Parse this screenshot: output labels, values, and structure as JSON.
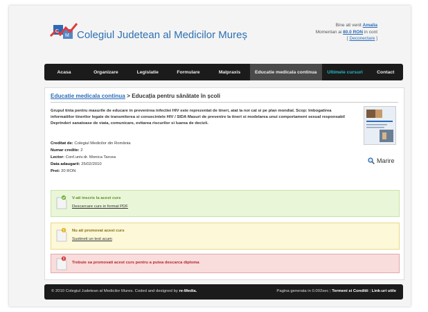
{
  "header": {
    "site_title": "Colegiul Judetean al Medicilor Mureș",
    "welcome": "Bine ati venit",
    "user_name": "Amalia",
    "balance_prefix": "Momentan ai",
    "balance": "80.0 RON",
    "balance_suffix": "in cont",
    "logout": "Deconectare"
  },
  "nav": {
    "items": [
      "Acasa",
      "Organizare",
      "Legislatie",
      "Formulare",
      "Malpraxis",
      "Educatie medicala continua",
      "Ultimele cursuri",
      "Contact"
    ]
  },
  "breadcrumb": {
    "parent": "Educatie medicala continua",
    "separator": ">",
    "current": "Educația pentru sănătate în școli"
  },
  "course": {
    "description": "Grupul tinta pentru masurile de educare in prevenirea infectiei HIV este reprezentat de tineri, atat la noi cat si pe plan mondial. Scop: Imbogatirea informatiilor tinerilor legate de transmiterea si consecintele HIV / SIDA Masuri de prevenire la tineri si modelarea unui comportament sexual responsabil Deprinderi sanatoase de viata, comunicare, evitarea riscurilor si luarea de decizii.",
    "zoom_label": "Marire",
    "credited_label": "Creditat de:",
    "credited_value": "Colegiul Medicilor din România",
    "credits_label": "Numar credite:",
    "credits_value": "2",
    "lector_label": "Lector:",
    "lector_value": "Conf.univ.dr. Monica Tarcea",
    "date_label": "Data adaugarii:",
    "date_value": "25/02/2010",
    "price_label": "Pret:",
    "price_value": "20 RON"
  },
  "status": {
    "enrolled_title": "V-ati inscris la acest curs",
    "enrolled_link": "Descarcare curs in format PDF",
    "not_passed_title": "Nu ati promovat acest curs",
    "not_passed_link": "Sustineti un test acum",
    "must_pass": "Trebuie sa promovati acest curs pentru a putea descarca diploma"
  },
  "footer": {
    "copyright": "© 2010 Colegiul Judetean al Medicilor Mures. Coded and designed by",
    "designer": "re-Media.",
    "generated": "Pagina generata in 0.002sec",
    "terms": "Termeni si Conditii",
    "links": "Link-uri utile"
  },
  "colors": {
    "accent": "#2a6bb8",
    "nav_bg": "#1b1b1b",
    "highlight": "#27b9c9",
    "success": "#eaf6d8",
    "warning": "#fcf8d8",
    "error": "#f9dcdc"
  }
}
